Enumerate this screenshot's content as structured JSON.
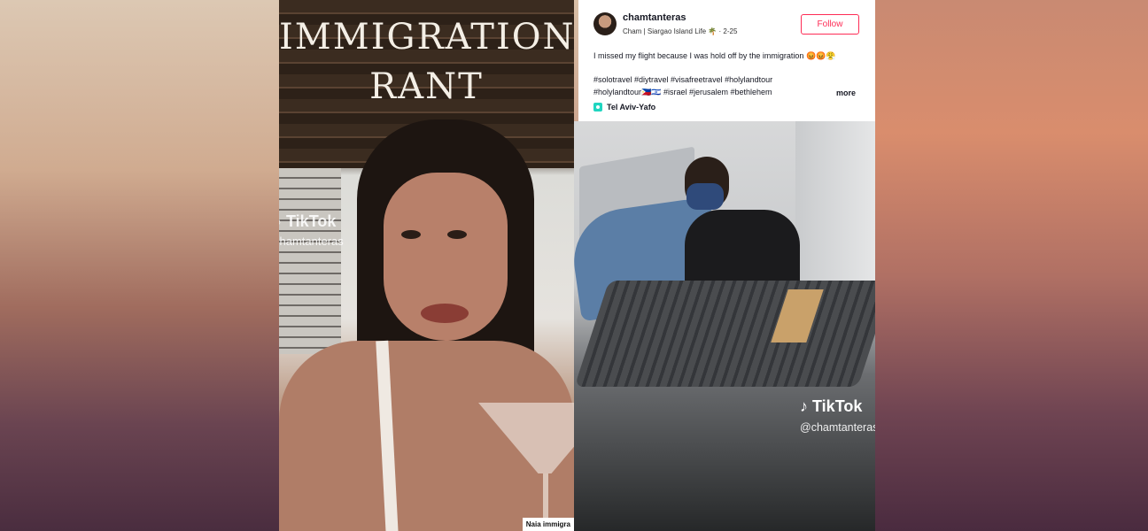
{
  "left_video": {
    "title_line1": "IMMIGRATION",
    "title_line2": "RANT",
    "watermark_brand": "TikTok",
    "watermark_handle": "chamtanteras",
    "caption_chip": "Naia immigra"
  },
  "post": {
    "username": "chamtanteras",
    "subline": "Cham | Siargao Island Life 🌴 · 2-25",
    "follow_label": "Follow",
    "description": "I missed my flight because I was hold off by the immigration 😡😡😤",
    "hashtags_line1": "#solotravel #diytravel #visafreetravel #holylandtour",
    "hashtags_line2": "#holylandtour🇵🇭🇮🇱 #israel #jerusalem #bethlehem",
    "more_label": "more",
    "location": "Tel Aviv-Yafo"
  },
  "right_video": {
    "watermark_brand": "TikTok",
    "watermark_handle": "@chamtanteras"
  },
  "icons": {
    "location": "location-pin-icon",
    "tiktok": "tiktok-logo-icon"
  },
  "colors": {
    "accent": "#fe2c55",
    "location": "#20d5c0"
  }
}
